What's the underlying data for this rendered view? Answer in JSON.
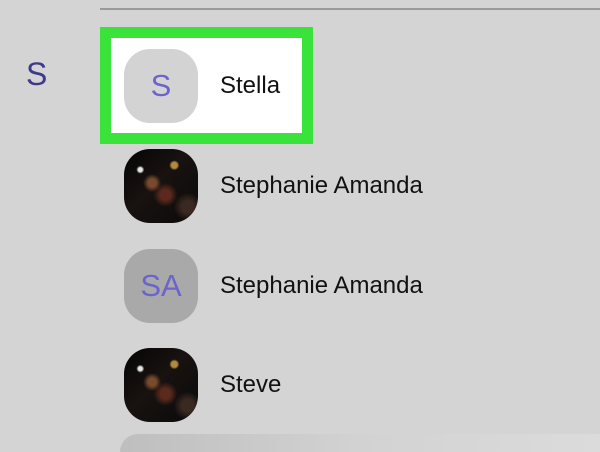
{
  "section_index": {
    "letter": "S"
  },
  "contacts": [
    {
      "name": "Stella",
      "avatar_type": "initials",
      "initials": "S",
      "highlighted": true
    },
    {
      "name": "Stephanie Amanda",
      "avatar_type": "photo",
      "initials": ""
    },
    {
      "name": "Stephanie Amanda",
      "avatar_type": "initials",
      "initials": "SA"
    },
    {
      "name": "Steve",
      "avatar_type": "photo",
      "initials": ""
    }
  ],
  "colors": {
    "background": "#d4d4d4",
    "highlight_border": "#39e33a",
    "initials_text": "#6b64cc",
    "section_letter": "#3d3a8c"
  }
}
